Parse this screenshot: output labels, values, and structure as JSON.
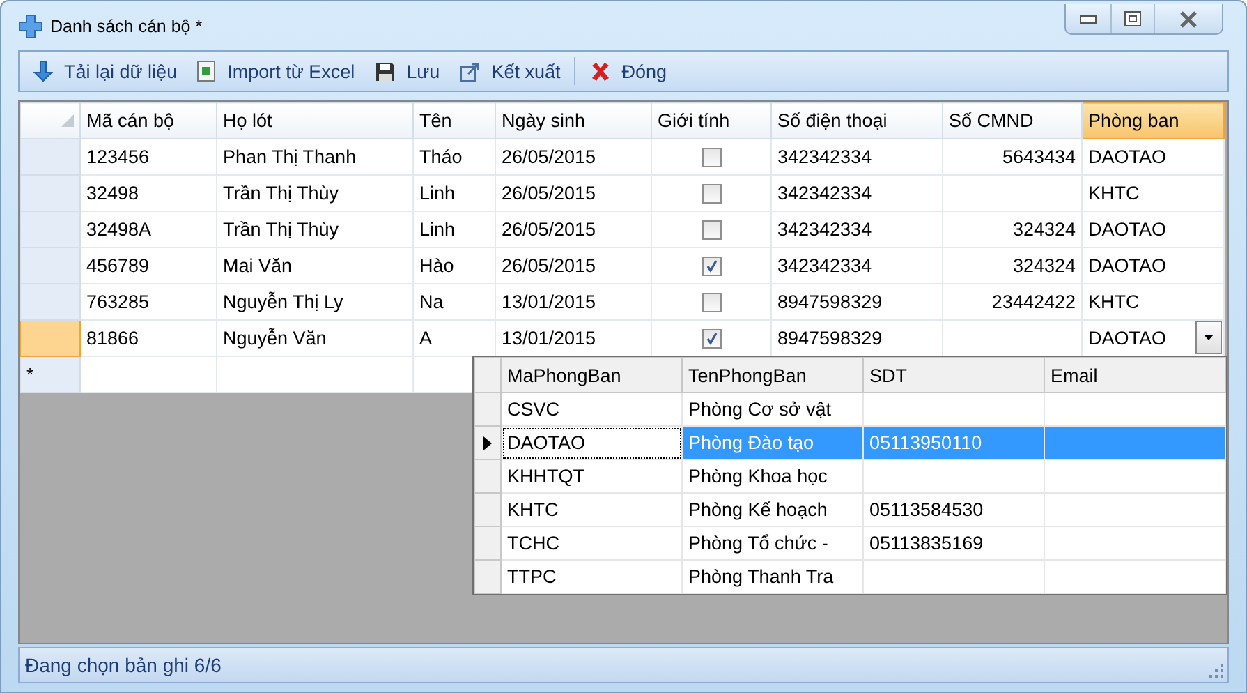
{
  "window": {
    "title": "Danh sách cán bộ *"
  },
  "toolbar": [
    {
      "kind": "reload",
      "label": "Tải lại dữ liệu"
    },
    {
      "kind": "excel",
      "label": "Import từ Excel"
    },
    {
      "kind": "save",
      "label": "Lưu"
    },
    {
      "kind": "export",
      "label": "Kết xuất"
    },
    {
      "kind": "close",
      "label": "Đóng"
    }
  ],
  "grid": {
    "columns": [
      {
        "label": "Mã cán bộ",
        "kind": "text",
        "selected": false
      },
      {
        "label": "Họ lót",
        "kind": "text",
        "selected": false
      },
      {
        "label": "Tên",
        "kind": "text",
        "selected": false
      },
      {
        "label": "Ngày sinh",
        "kind": "text",
        "selected": false
      },
      {
        "label": "Giới tính",
        "kind": "check",
        "selected": false
      },
      {
        "label": "Số điện thoại",
        "kind": "text",
        "selected": false
      },
      {
        "label": "Số CMND",
        "kind": "number",
        "selected": false
      },
      {
        "label": "Phòng ban",
        "kind": "combo",
        "selected": true
      }
    ],
    "rows": [
      {
        "selected": false,
        "cells": [
          {
            "text": "123456"
          },
          {
            "text": "Phan Thị Thanh"
          },
          {
            "text": "Tháo"
          },
          {
            "text": "26/05/2015"
          },
          {
            "checked": false
          },
          {
            "text": "342342334"
          },
          {
            "text": "5643434"
          },
          {
            "text": "DAOTAO"
          }
        ]
      },
      {
        "selected": false,
        "cells": [
          {
            "text": "32498"
          },
          {
            "text": "Trần Thị Thùy"
          },
          {
            "text": "Linh"
          },
          {
            "text": "26/05/2015"
          },
          {
            "checked": false
          },
          {
            "text": "342342334"
          },
          {},
          {
            "text": "KHTC"
          }
        ]
      },
      {
        "selected": false,
        "cells": [
          {
            "text": "32498A"
          },
          {
            "text": "Trần Thị Thùy"
          },
          {
            "text": "Linh"
          },
          {
            "text": "26/05/2015"
          },
          {
            "checked": false
          },
          {
            "text": "342342334"
          },
          {
            "text": "324324"
          },
          {
            "text": "DAOTAO"
          }
        ]
      },
      {
        "selected": false,
        "cells": [
          {
            "text": "456789"
          },
          {
            "text": "Mai Văn"
          },
          {
            "text": "Hào"
          },
          {
            "text": "26/05/2015"
          },
          {
            "checked": true
          },
          {
            "text": "342342334"
          },
          {
            "text": "324324"
          },
          {
            "text": "DAOTAO"
          }
        ]
      },
      {
        "selected": false,
        "cells": [
          {
            "text": "763285"
          },
          {
            "text": "Nguyễn Thị Ly"
          },
          {
            "text": "Na"
          },
          {
            "text": "13/01/2015"
          },
          {
            "checked": false
          },
          {
            "text": "8947598329"
          },
          {
            "text": "23442422"
          },
          {
            "text": "KHTC"
          }
        ]
      },
      {
        "selected": true,
        "cells": [
          {
            "text": "81866"
          },
          {
            "text": "Nguyễn Văn"
          },
          {
            "text": "A"
          },
          {
            "text": "13/01/2015"
          },
          {
            "checked": true
          },
          {
            "text": "8947598329"
          },
          {},
          {
            "text": "DAOTAO"
          }
        ]
      }
    ],
    "new_row_marker": "*"
  },
  "dropdown": {
    "columns": [
      "MaPhongBan",
      "TenPhongBan",
      "SDT",
      "Email"
    ],
    "rows": [
      {
        "selected": false,
        "cells": [
          {
            "text": "CSVC"
          },
          {
            "text": "Phòng Cơ sở vật"
          },
          {},
          {}
        ]
      },
      {
        "selected": true,
        "cells": [
          {
            "text": "DAOTAO"
          },
          {
            "text": "Phòng Đào tạo"
          },
          {
            "text": "05113950110"
          },
          {}
        ]
      },
      {
        "selected": false,
        "cells": [
          {
            "text": "KHHTQT"
          },
          {
            "text": "Phòng Khoa học"
          },
          {},
          {}
        ]
      },
      {
        "selected": false,
        "cells": [
          {
            "text": "KHTC"
          },
          {
            "text": "Phòng Kế hoạch"
          },
          {
            "text": "05113584530"
          },
          {}
        ]
      },
      {
        "selected": false,
        "cells": [
          {
            "text": "TCHC"
          },
          {
            "text": "Phòng Tổ chức -"
          },
          {
            "text": "05113835169"
          },
          {}
        ]
      },
      {
        "selected": false,
        "cells": [
          {
            "text": "TTPC"
          },
          {
            "text": "Phòng Thanh Tra"
          },
          {},
          {}
        ]
      }
    ]
  },
  "status_bar": {
    "text": "Đang chọn bản ghi 6/6"
  }
}
